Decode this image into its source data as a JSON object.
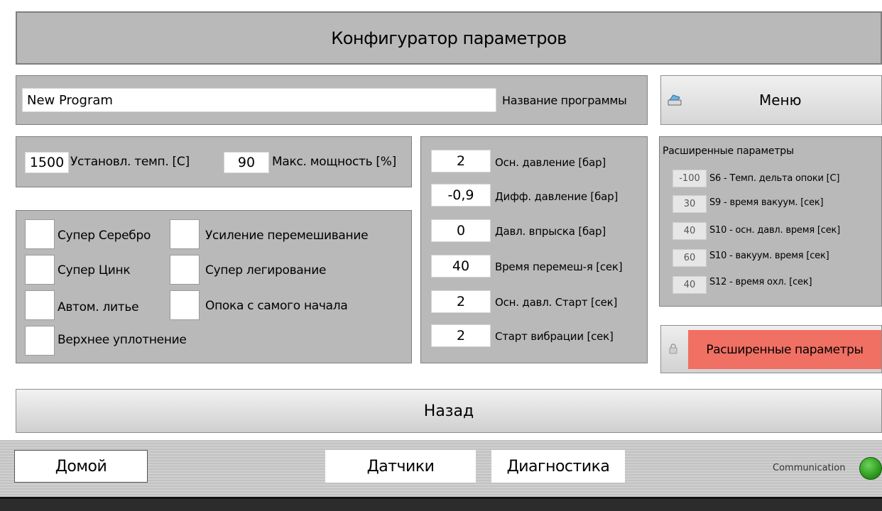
{
  "header": {
    "title": "Конфигуратор параметров"
  },
  "program": {
    "name_value": "New Program",
    "name_label": "Название программы"
  },
  "menu": {
    "label": "Меню"
  },
  "temp_power": {
    "temp_value": "1500",
    "temp_label": "Установл. темп. [C]",
    "power_value": "90",
    "power_label": "Макс. мощность [%]"
  },
  "options": {
    "super_silver": "Супер Серебро",
    "super_zinc": "Супер Цинк",
    "auto_casting": "Автом. литье",
    "top_seal": "Верхнее уплотнение",
    "enhanced_mixing": "Усиление перемешивание",
    "super_alloying": "Супер легирование",
    "flask_from_start": "Опока с самого начала"
  },
  "pressure": [
    {
      "value": "2",
      "label": "Осн. давление [бар]"
    },
    {
      "value": "-0,9",
      "label": "Дифф. давление [бар]"
    },
    {
      "value": "0",
      "label": "Давл. впрыска [бар]"
    },
    {
      "value": "40",
      "label": "Время перемеш-я [сек]"
    },
    {
      "value": "2",
      "label": "Осн. давл. Старт [сек]"
    },
    {
      "value": "2",
      "label": "Старт вибрации [сек]"
    }
  ],
  "advanced": {
    "title": "Расширенные параметры",
    "rows": [
      {
        "value": "-100",
        "label": "S6 - Темп. дельта опоки [C]"
      },
      {
        "value": "30",
        "label": "S9 - время вакуум. [сек]"
      },
      {
        "value": "40",
        "label": "S10 - осн. давл. время [сек]"
      },
      {
        "value": "60",
        "label": "S10 - вакуум. время [сек]"
      },
      {
        "value": "40",
        "label": "S12 - время охл. [сек]"
      }
    ],
    "button_label": "Расширенные параметры",
    "button_color": "#f07063"
  },
  "back": {
    "label": "Назад"
  },
  "nav": {
    "home": "Домой",
    "sensors": "Датчики",
    "diagnostics": "Диагностика",
    "communication": "Communication",
    "status_color": "#2e9a1e"
  }
}
